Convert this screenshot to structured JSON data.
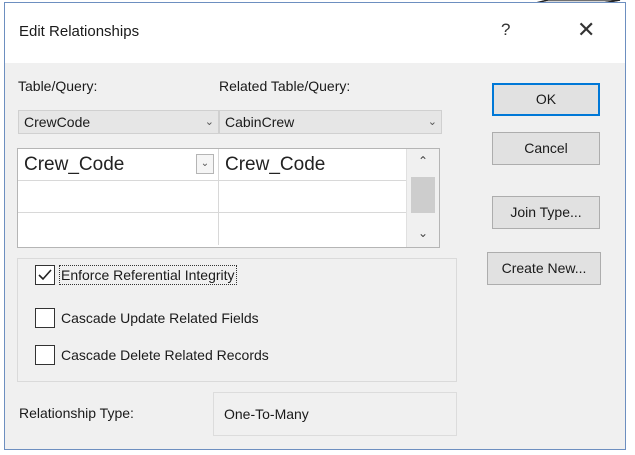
{
  "window": {
    "title": "Edit Relationships",
    "help_glyph": "?",
    "close_glyph": "✕"
  },
  "table_query": {
    "label": "Table/Query:",
    "value": "CrewCode"
  },
  "related_table_query": {
    "label": "Related Table/Query:",
    "value": "CabinCrew"
  },
  "field_grid": {
    "rows": [
      {
        "left": "Crew_Code",
        "right": "Crew_Code"
      },
      {
        "left": "",
        "right": ""
      },
      {
        "left": "",
        "right": ""
      }
    ]
  },
  "options": {
    "enforce_referential_integrity": {
      "label": "Enforce Referential Integrity",
      "checked": true
    },
    "cascade_update": {
      "label": "Cascade Update Related Fields",
      "checked": false
    },
    "cascade_delete": {
      "label": "Cascade Delete Related Records",
      "checked": false
    }
  },
  "relationship_type": {
    "label": "Relationship Type:",
    "value": "One-To-Many"
  },
  "buttons": {
    "ok": "OK",
    "cancel": "Cancel",
    "join_type": "Join Type...",
    "create_new": "Create New..."
  }
}
